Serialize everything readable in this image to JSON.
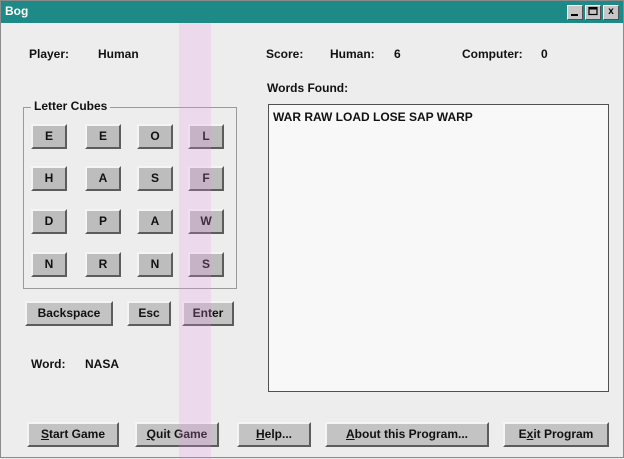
{
  "window": {
    "title": "Bog",
    "controls": [
      "minimize-icon",
      "maximize-icon",
      "close-icon"
    ],
    "close_glyph": "x"
  },
  "player": {
    "label": "Player:",
    "value": "Human"
  },
  "score": {
    "label": "Score:",
    "human_label": "Human:",
    "human_value": "6",
    "computer_label": "Computer:",
    "computer_value": "0"
  },
  "letter_cubes": {
    "title": "Letter Cubes",
    "rows": [
      [
        "E",
        "E",
        "O",
        "L"
      ],
      [
        "H",
        "A",
        "S",
        "F"
      ],
      [
        "D",
        "P",
        "A",
        "W"
      ],
      [
        "N",
        "R",
        "N",
        "S"
      ]
    ]
  },
  "edit_buttons": {
    "backspace": "Backspace",
    "esc": "Esc",
    "enter": "Enter"
  },
  "word": {
    "label": "Word:",
    "value": "NASA"
  },
  "words_found": {
    "label": "Words Found:",
    "text": "WAR RAW LOAD LOSE SAP WARP"
  },
  "bottom_buttons": {
    "start": {
      "ul": "S",
      "rest": "tart Game"
    },
    "quit": {
      "ul": "Q",
      "rest": "uit Game"
    },
    "help": {
      "ul": "H",
      "rest": "elp..."
    },
    "about": {
      "ul": "A",
      "rest": "bout this Program..."
    },
    "exit": {
      "pre": "E",
      "ul": "x",
      "rest": "it Program"
    }
  },
  "colors": {
    "titlebar": "#1e8a88",
    "window_bg": "#ededed",
    "button_face": "#c3c3c3"
  }
}
